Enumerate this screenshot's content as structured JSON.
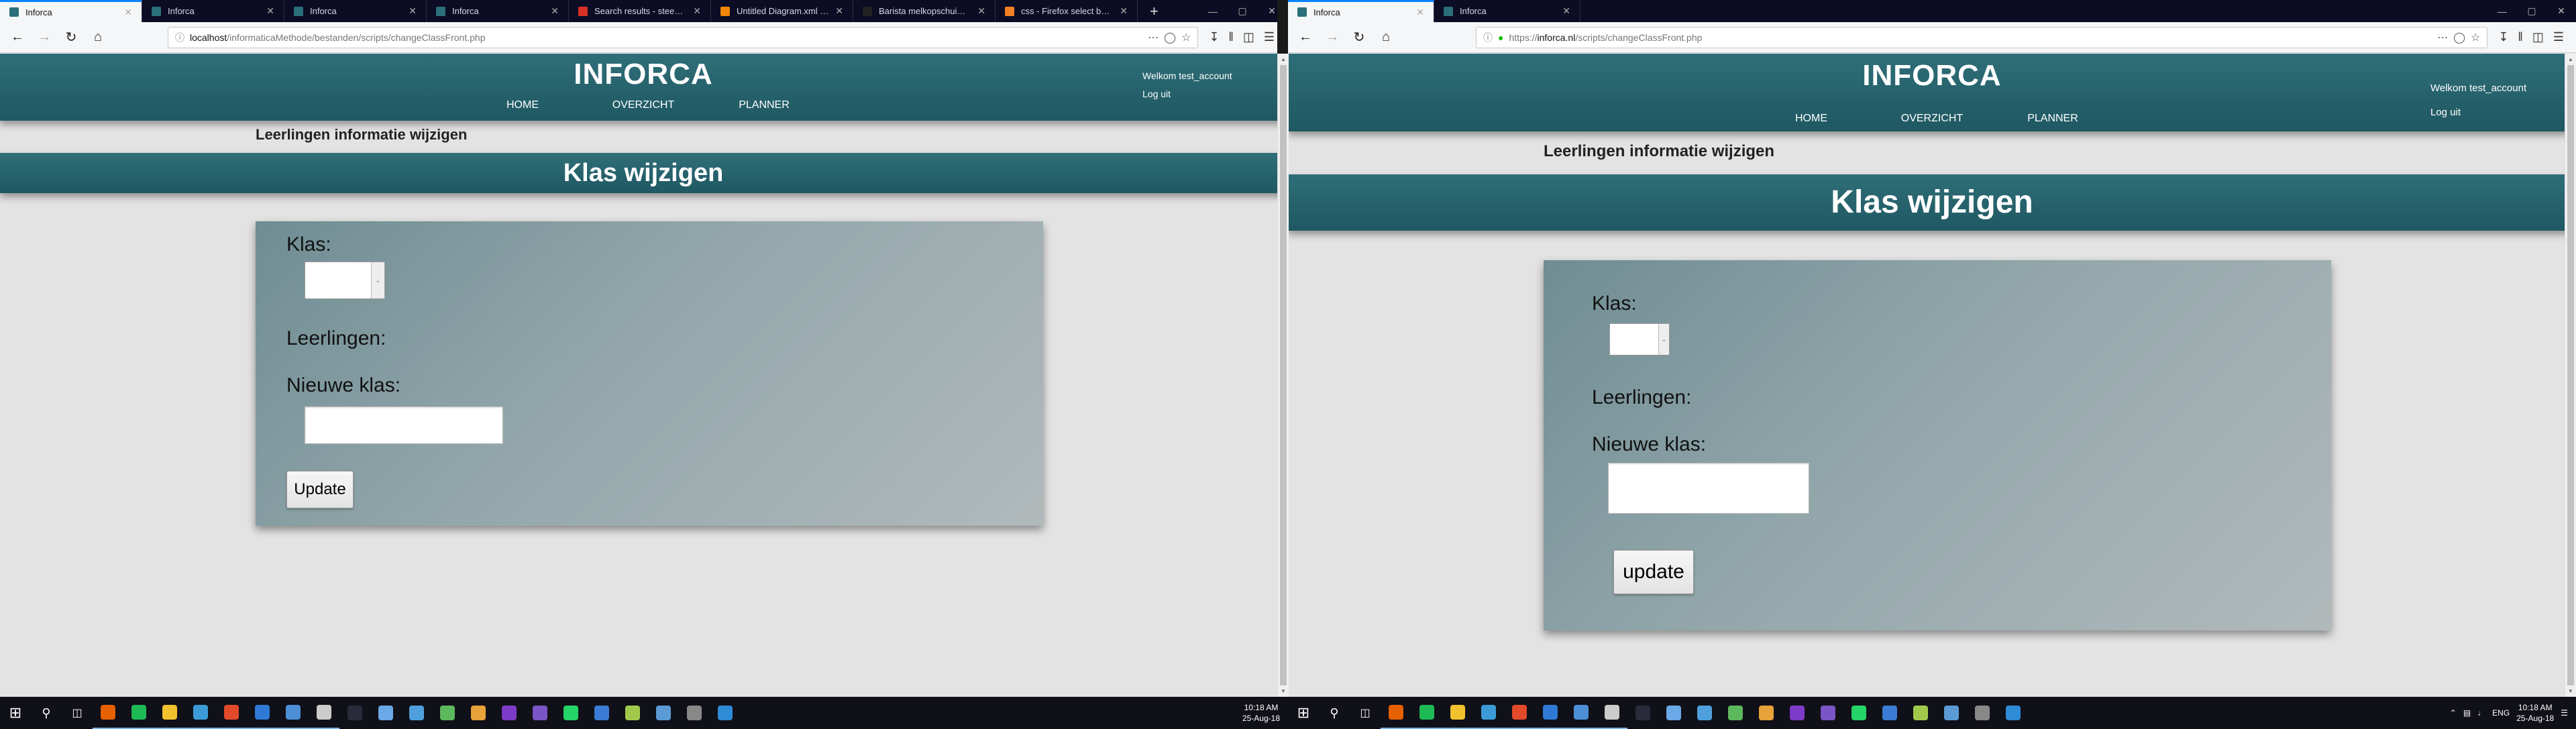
{
  "left": {
    "tabs": [
      {
        "title": "Inforca",
        "active": true,
        "color": "#2a6f7a"
      },
      {
        "title": "Inforca",
        "active": false,
        "color": "#2a6f7a"
      },
      {
        "title": "Inforca",
        "active": false,
        "color": "#2a6f7a"
      },
      {
        "title": "Inforca",
        "active": false,
        "color": "#2a6f7a"
      },
      {
        "title": "Search results - steeman.m...",
        "active": false,
        "color": "#d93025"
      },
      {
        "title": "Untitled Diagram.xml - draw...",
        "active": false,
        "color": "#f08705"
      },
      {
        "title": "Barista melkopschuimer | Ro...",
        "active": false,
        "color": "#222222"
      },
      {
        "title": "css - Firefox select box - rem...",
        "active": false,
        "color": "#f48024"
      }
    ],
    "url_host": "localhost",
    "url_path": "/informaticaMethode/bestanden/scripts/changeClassFront.php"
  },
  "right": {
    "tabs": [
      {
        "title": "Inforca",
        "active": true,
        "color": "#2a6f7a"
      },
      {
        "title": "Inforca",
        "active": false,
        "color": "#2a6f7a"
      }
    ],
    "url_prefix": "https://",
    "url_host": "inforca.nl",
    "url_path": "/scripts/changeClassFront.php"
  },
  "site": {
    "brand": "INFORCA",
    "nav": [
      "HOME",
      "OVERZICHT",
      "PLANNER"
    ],
    "welcome": "Welkom test_account",
    "logout": "Log uit",
    "subtitle": "Leerlingen informatie wijzigen",
    "banner": "Klas wijzigen"
  },
  "form_left": {
    "klas_label": "Klas:",
    "leerlingen_label": "Leerlingen:",
    "nieuwe_label": "Nieuwe klas:",
    "update_label": "Update"
  },
  "form_right": {
    "klas_label": "Klas:",
    "leerlingen_label": "Leerlingen:",
    "nieuwe_label": "Nieuwe klas:",
    "update_label": "update"
  },
  "taskbar": {
    "time": "10:18 AM",
    "date": "25-Aug-18",
    "lang": "ENG",
    "icons": [
      "#e66000",
      "#1db954",
      "#f2c12e",
      "#3c9bd7",
      "#e24a2a",
      "#2f7ad6",
      "#4d8fd6",
      "#cccccc",
      "#2a2a3a",
      "#6aa8e8",
      "#4ea0dc",
      "#5cb85c",
      "#e8a23a",
      "#7d3cc8",
      "#7a55c8",
      "#25d366",
      "#3a7bd5",
      "#a0c84a",
      "#5a9bd5",
      "#888888",
      "#2e8bd6"
    ]
  },
  "colors": {
    "accent": "#2a6f7a",
    "page_bg": "#e3e3e3"
  }
}
